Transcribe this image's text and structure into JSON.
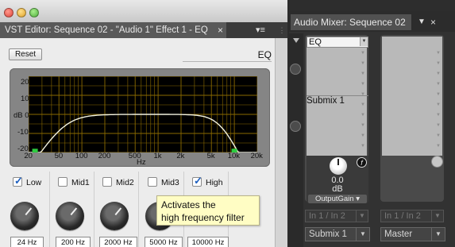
{
  "vst_editor": {
    "tab_title": "VST Editor: Sequence 02 - \"Audio 1\" Effect 1 - EQ",
    "close_glyph": "×",
    "panel_menu_glyph": "▾≡",
    "reset_label": "Reset",
    "effect_name": "EQ",
    "graph": {
      "y_ticks": [
        "20",
        "10",
        "dB 0",
        "-10",
        "-20"
      ],
      "x_ticks": [
        "20",
        "50",
        "100",
        "200",
        "500",
        "1k",
        "2k",
        "5k",
        "10k",
        "20k"
      ],
      "x_unit": "Hz",
      "y_range_db": [
        -20,
        20
      ],
      "x_range_hz": [
        20,
        20000
      ],
      "colors": {
        "background": "#000000",
        "grid": "#8a6a00",
        "curve": "#f2f2e0",
        "handle": "#2ecc40"
      }
    },
    "bands": [
      {
        "label": "Low",
        "checked": true,
        "freq": "24 Hz"
      },
      {
        "label": "Mid1",
        "checked": false,
        "freq": "200 Hz"
      },
      {
        "label": "Mid2",
        "checked": false,
        "freq": "2000 Hz"
      },
      {
        "label": "Mid3",
        "checked": false,
        "freq": "5000 Hz"
      },
      {
        "label": "High",
        "checked": true,
        "freq": "10000 Hz"
      }
    ],
    "tooltip": {
      "line1": "Activates the",
      "line2": "high frequency filter"
    }
  },
  "audio_mixer": {
    "tab_title": "Audio Mixer: Sequence 02",
    "close_glyph": "×",
    "track1": {
      "effect_slot": "EQ",
      "send_slot": "Submix 1",
      "fx_glyph": "f",
      "value": "0.0",
      "unit": "dB",
      "param": "OutputGain",
      "input": "In 1 / In 2",
      "output": "Submix 1"
    },
    "track2": {
      "input": "In 1 / In 2",
      "output": "Master"
    }
  }
}
